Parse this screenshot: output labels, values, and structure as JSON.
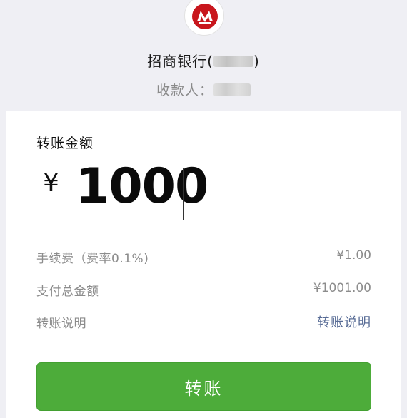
{
  "payee": {
    "bank_name": "招商银行(",
    "bank_suffix": ")",
    "recipient_label": "收款人："
  },
  "transfer": {
    "amount_label": "转账金额",
    "currency_symbol": "¥",
    "amount": "1000"
  },
  "details": [
    {
      "label": "手续费（费率0.1%)",
      "value": "¥1.00"
    },
    {
      "label": "支付总金额",
      "value": "¥1001.00"
    },
    {
      "label": "转账说明",
      "link": "转账说明"
    }
  ],
  "submit_label": "转账",
  "colors": {
    "primary_green": "#4dac3a",
    "link_blue": "#576b95",
    "logo_red": "#c8161d"
  }
}
